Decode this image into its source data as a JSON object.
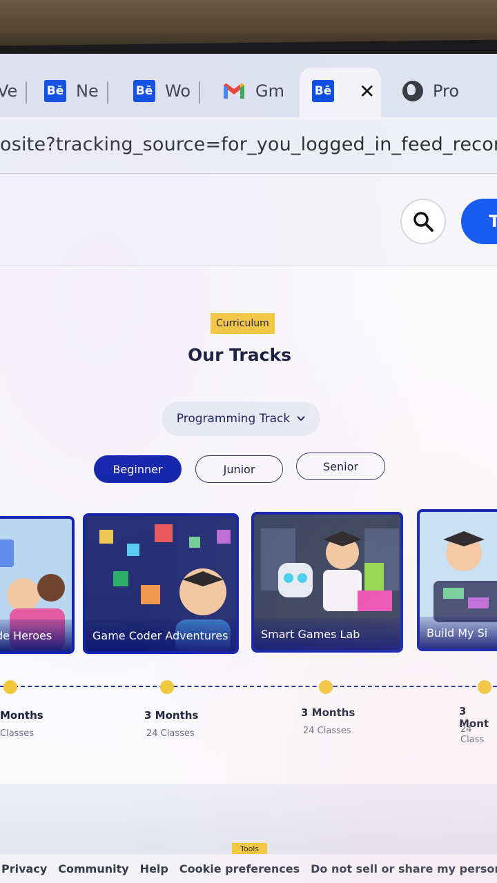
{
  "browser": {
    "tabs": [
      {
        "label": "Ve",
        "icon": "none"
      },
      {
        "label": "Ne",
        "icon": "behance-icon",
        "icon_text": "Bē"
      },
      {
        "label": "Wo",
        "icon": "behance-icon",
        "icon_text": "Bē"
      },
      {
        "label": "Gm",
        "icon": "gmail-icon"
      },
      {
        "label": "",
        "icon": "behance-icon",
        "icon_text": "Bē",
        "active": true,
        "close": "✕"
      },
      {
        "label": "Pro",
        "icon": "globe-icon"
      }
    ],
    "url": "osite?tracking_source=for_you_logged_in_feed_recommend"
  },
  "site": {
    "cta_label": "T"
  },
  "project": {
    "badge": "Curriculum",
    "title": "Our Tracks",
    "track_select": "Programming Track",
    "levels": [
      {
        "label": "Beginner",
        "active": true
      },
      {
        "label": "Junior",
        "active": false
      },
      {
        "label": "Senior",
        "active": false
      }
    ],
    "courses": [
      {
        "title": "de Heroes",
        "duration": "Months",
        "classes": "Classes"
      },
      {
        "title": "Game Coder Adventures",
        "duration": "3 Months",
        "classes": "24 Classes"
      },
      {
        "title": "Smart Games Lab",
        "duration": "3 Months",
        "classes": "24 Classes"
      },
      {
        "title": "Build My Si",
        "duration": "3 Mont",
        "classes": "24 Class"
      }
    ],
    "tools_label": "Tools"
  },
  "footer": {
    "links": [
      "Privacy",
      "Community",
      "Help",
      "Cookie preferences",
      "Do not sell or share my personal i"
    ]
  },
  "colors": {
    "accent_blue": "#0c1fa8",
    "badge_yellow": "#f5c93e",
    "behance_blue": "#0a4de0"
  }
}
